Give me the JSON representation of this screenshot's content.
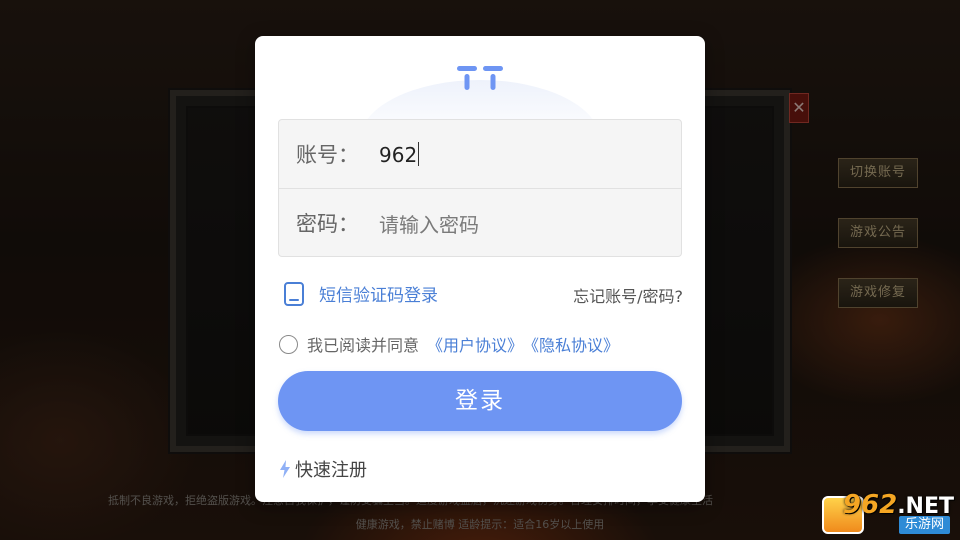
{
  "game": {
    "side_buttons": [
      "切换账号",
      "游戏公告",
      "游戏修复"
    ],
    "close_glyph": "✕",
    "notice_line1": "抵制不良游戏，拒绝盗版游戏。注意自我保护，谨防受骗上当。适度游戏益脑，沉迷游戏伤身。合理安排时间，享受健康生活",
    "notice_line2": "健康游戏，禁止赌博  适龄提示：适合16岁以上使用"
  },
  "watermark": {
    "top": "962",
    "top_suffix": ".NET",
    "bottom": "乐游网"
  },
  "login": {
    "account_label": "账号：",
    "account_value": "962",
    "password_label": "密码：",
    "password_placeholder": "请输入密码",
    "sms_login": "短信验证码登录",
    "forgot": "忘记账号/密码?",
    "agree_text": "我已阅读并同意",
    "user_agreement": "《用户协议》",
    "privacy_agreement": "《隐私协议》",
    "login_button": "登录",
    "quick_register": "快速注册",
    "icons": {
      "logo": "tt-logo-icon",
      "sms": "phone-icon",
      "quick": "lightning-icon"
    },
    "colors": {
      "accent": "#6e95f3",
      "link": "#4a7fd6"
    }
  }
}
